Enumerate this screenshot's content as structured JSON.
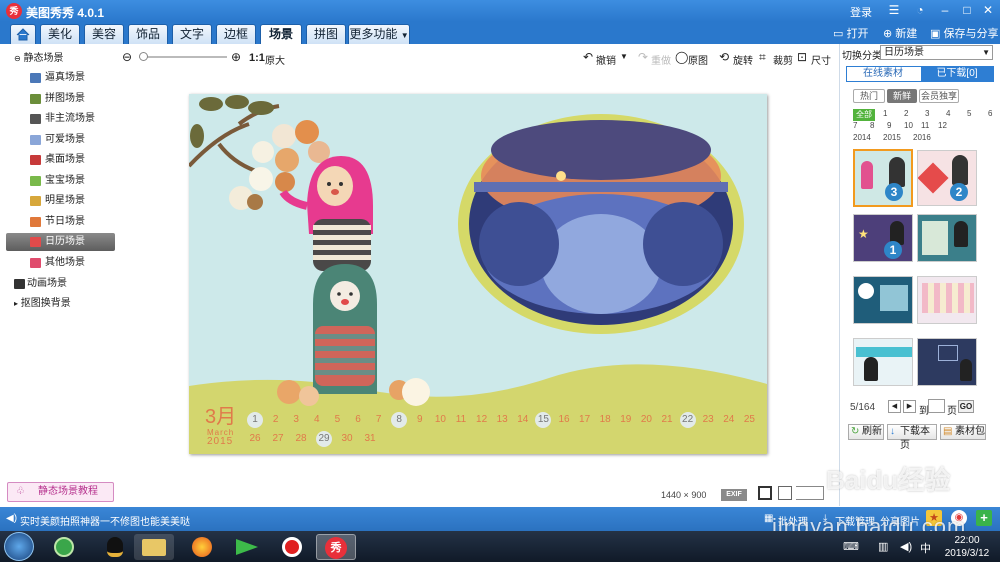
{
  "app": {
    "title": "美图秀秀 4.0.1",
    "logo_text": "秀",
    "login": "登录"
  },
  "tabs": [
    {
      "label": ""
    },
    {
      "label": "美化"
    },
    {
      "label": "美容"
    },
    {
      "label": "饰品"
    },
    {
      "label": "文字"
    },
    {
      "label": "边框"
    },
    {
      "label": "场景"
    },
    {
      "label": "拼图"
    },
    {
      "label": "更多功能"
    }
  ],
  "header_actions": {
    "open": "打开",
    "new": "新建",
    "save": "保存与分享"
  },
  "toolbar": {
    "zoom_ratio": "1:1",
    "original_size": "原大",
    "undo": "撤销",
    "redo": "重做",
    "original": "原图",
    "rotate": "旋转",
    "crop": "裁剪",
    "size": "尺寸"
  },
  "sidebar": {
    "groups": [
      {
        "label": "静态场景",
        "expanded": true
      },
      {
        "label": "动画场景"
      },
      {
        "label": "抠图换背景"
      }
    ],
    "items": [
      {
        "label": "逼真场景"
      },
      {
        "label": "拼图场景"
      },
      {
        "label": "非主流场景"
      },
      {
        "label": "可爱场景"
      },
      {
        "label": "桌面场景"
      },
      {
        "label": "宝宝场景"
      },
      {
        "label": "明星场景"
      },
      {
        "label": "节日场景"
      },
      {
        "label": "日历场景",
        "selected": true
      },
      {
        "label": "其他场景"
      }
    ],
    "tutorial": "静态场景教程"
  },
  "calendar": {
    "month": "3月",
    "month_en": "March",
    "year": "2015",
    "row1": [
      "1",
      "2",
      "3",
      "4",
      "5",
      "6",
      "7",
      "8",
      "9",
      "10",
      "11",
      "12",
      "13",
      "14",
      "15",
      "16",
      "17",
      "18",
      "19",
      "20",
      "21",
      "22",
      "23",
      "24",
      "25"
    ],
    "row2": [
      "26",
      "27",
      "28",
      "29",
      "30",
      "31"
    ],
    "highlighted": [
      "1",
      "8",
      "15",
      "22",
      "29"
    ]
  },
  "canvas_info": {
    "width": "1440",
    "times": "×",
    "height": "900",
    "exif": "EXIF"
  },
  "right_panel": {
    "category_label": "切换分类",
    "category_value": "日历场景",
    "tabs": [
      "在线素材",
      "已下载[0]"
    ],
    "filters": [
      "热门",
      "新鲜",
      "会员独享"
    ],
    "active_filter": "新鲜",
    "all_label": "全部",
    "months_row1": [
      "1",
      "2",
      "3",
      "4",
      "5",
      "6"
    ],
    "months_row2": [
      "7",
      "8",
      "9",
      "10",
      "11",
      "12"
    ],
    "years": [
      "2014",
      "2015",
      "2016"
    ],
    "badges": [
      "3",
      "2",
      "1"
    ],
    "pager": {
      "page": "5/164",
      "goto": "到",
      "unit": "页",
      "go": "GO"
    },
    "buttons": {
      "refresh": "刷新",
      "download_page": "下载本页",
      "library": "素材包"
    }
  },
  "statusbar": {
    "message": "实时美颜拍照神器一不修图也能美美哒",
    "batch": "批处理",
    "download_mgr": "下载管理",
    "share": "分享图片"
  },
  "taskbar": {
    "time": "22:00",
    "date": "2019/3/12"
  },
  "watermark": {
    "text": "Baidu经验",
    "url": "jingyan.baidu.com"
  },
  "colors": {
    "title_blue": "#2a78cc",
    "canvas_bg": "#cde9ea",
    "ground_green": "#d3d66e",
    "accent_orange": "#e38f4c",
    "calendar_text": "#e07a4a"
  }
}
